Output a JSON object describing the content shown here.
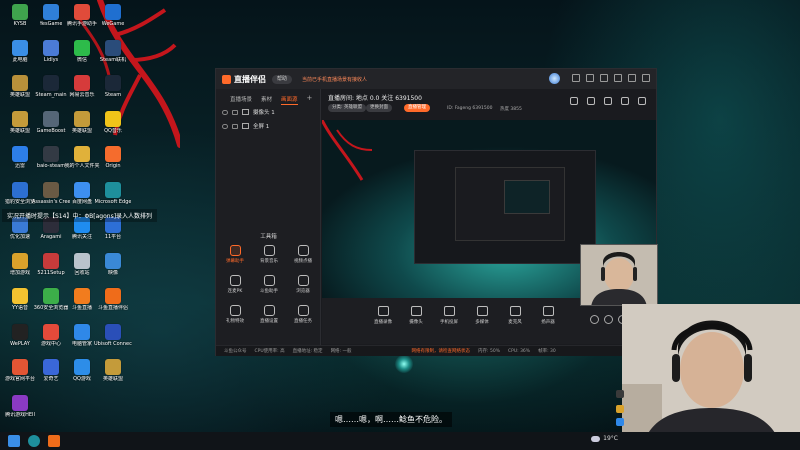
{
  "desktop": {
    "icons": [
      {
        "label": "KYSB",
        "color": "#3fa34d"
      },
      {
        "label": "YesGame\n游戏方式",
        "color": "#2f7fd8"
      },
      {
        "label": "腾讯手游助手",
        "color": "#e04b3a"
      },
      {
        "label": "WeGame",
        "color": "#1f6fd0"
      },
      {
        "label": "此电脑",
        "color": "#3a8ee6"
      },
      {
        "label": "Lidlys",
        "color": "#4b7bd6"
      },
      {
        "label": "微信",
        "color": "#2dbb4a"
      },
      {
        "label": "Steam联机",
        "color": "#2a4c7a"
      },
      {
        "label": "英雄联盟\nWeGame版",
        "color": "#b8903a"
      },
      {
        "label": "Steam_main",
        "color": "#1b2838"
      },
      {
        "label": "网易云音乐",
        "color": "#d63b3b"
      },
      {
        "label": "Steam",
        "color": "#1b2838"
      },
      {
        "label": "英雄联盟",
        "color": "#c49b3a"
      },
      {
        "label": "GameBoost",
        "color": "#556677"
      },
      {
        "label": "英雄联盟",
        "color": "#c49b3a"
      },
      {
        "label": "QQ音乐",
        "color": "#f0c419"
      },
      {
        "label": "迅雷",
        "color": "#2d7ee8"
      },
      {
        "label": "baio-steam",
        "color": "#333a44"
      },
      {
        "label": "我的个人文件夹",
        "color": "#e0b13a"
      },
      {
        "label": "Origin",
        "color": "#f56c2d"
      },
      {
        "label": "猎豹安全浏览",
        "color": "#2c6fd1"
      },
      {
        "label": "Assassin's Creed Od...",
        "color": "#6a5a44"
      },
      {
        "label": "百度网盘",
        "color": "#3d8ff0"
      },
      {
        "label": "Microsoft Edge",
        "color": "#1e8f9c"
      },
      {
        "label": "优化加速",
        "color": "#3a7ad6"
      },
      {
        "label": "Aragami",
        "color": "#2d2d3a"
      },
      {
        "label": "腾讯关注",
        "color": "#1f8cf0"
      },
      {
        "label": "11平台",
        "color": "#2d6fd6"
      },
      {
        "label": "增加游戏",
        "color": "#d9a22b"
      },
      {
        "label": "5211Setup",
        "color": "#c73b3b"
      },
      {
        "label": "回收站",
        "color": "#b9c3cc"
      },
      {
        "label": "映像",
        "color": "#3a89d6"
      },
      {
        "label": "YY语音",
        "color": "#f2c230"
      },
      {
        "label": "360安全浏览器",
        "color": "#3cae49"
      },
      {
        "label": "斗鱼直播",
        "color": "#f17c1e"
      },
      {
        "label": "斗鱼直播伴侣",
        "color": "#ef6c1a"
      },
      {
        "label": "WePLAY",
        "color": "#222"
      },
      {
        "label": "游戏中心",
        "color": "#e44a3a"
      },
      {
        "label": "电脑管家",
        "color": "#2f88e8"
      },
      {
        "label": "Ubisoft Connect",
        "color": "#2a4fb8"
      },
      {
        "label": "游戏官网平台",
        "color": "#e25534"
      },
      {
        "label": "爱奇艺",
        "color": "#3a67d8"
      },
      {
        "label": "QQ游戏",
        "color": "#2d8de8"
      },
      {
        "label": "英雄联盟\nWeGame版",
        "color": "#c49b3a"
      },
      {
        "label": "腾讯游戏HEII",
        "color": "#8a3ac4"
      }
    ],
    "overlay_notice": "实况开播时提示【S14】中：ΦB[agons]录入人数排列"
  },
  "app": {
    "title": "直播伴侣",
    "version_badge": "帮助",
    "notice": "当前已手机直播场景有接收人",
    "tabs": [
      "直播场景",
      "素材",
      "画面源"
    ],
    "active_tab": 2,
    "sources": [
      {
        "name": "摄像头 1"
      },
      {
        "name": "全屏 1"
      }
    ],
    "tools_title": "工具箱",
    "tools": [
      {
        "label": "弹幕助手",
        "highlight": true
      },
      {
        "label": "背景音乐",
        "highlight": false
      },
      {
        "label": "视频点播",
        "highlight": false
      },
      {
        "label": "连麦PK",
        "highlight": false
      },
      {
        "label": "斗鱼助手",
        "highlight": false
      },
      {
        "label": "浏览器",
        "highlight": false
      },
      {
        "label": "礼物特效",
        "highlight": false
      },
      {
        "label": "直播设置",
        "highlight": false
      },
      {
        "label": "直播任务",
        "highlight": false
      }
    ],
    "room": {
      "title": "直播房间: 地点 0.0 关注 6391500",
      "pill_category": "分类: 英雄联盟",
      "pill_change": "更换封面",
      "pill_live": "直播管理",
      "meta_id": "ID: Fageng 6391500",
      "meta_heat": "热度 3855"
    },
    "bottom_tools": [
      {
        "label": "直播录像"
      },
      {
        "label": "摄像头"
      },
      {
        "label": "手机投屏"
      },
      {
        "label": "多媒体"
      },
      {
        "label": "麦克风"
      },
      {
        "label": "扬声器"
      }
    ],
    "status": {
      "left": "斗鱼公众号",
      "mid1": "CPU使用率: 高",
      "mid2": "直播地址: 稳定",
      "mid3": "网络: 一般",
      "warn": "网络有限制，请检查网络状态",
      "r1": "内存: 50%",
      "r2": "CPU: 36%",
      "r3": "帧率: 30"
    }
  },
  "subtitle": "嗯……嗯，啊……鲶鱼不危险。",
  "taskbar": {
    "weather": "19°C"
  },
  "colors": {
    "accent": "#ff6a2a",
    "panel": "#1d1e22"
  }
}
